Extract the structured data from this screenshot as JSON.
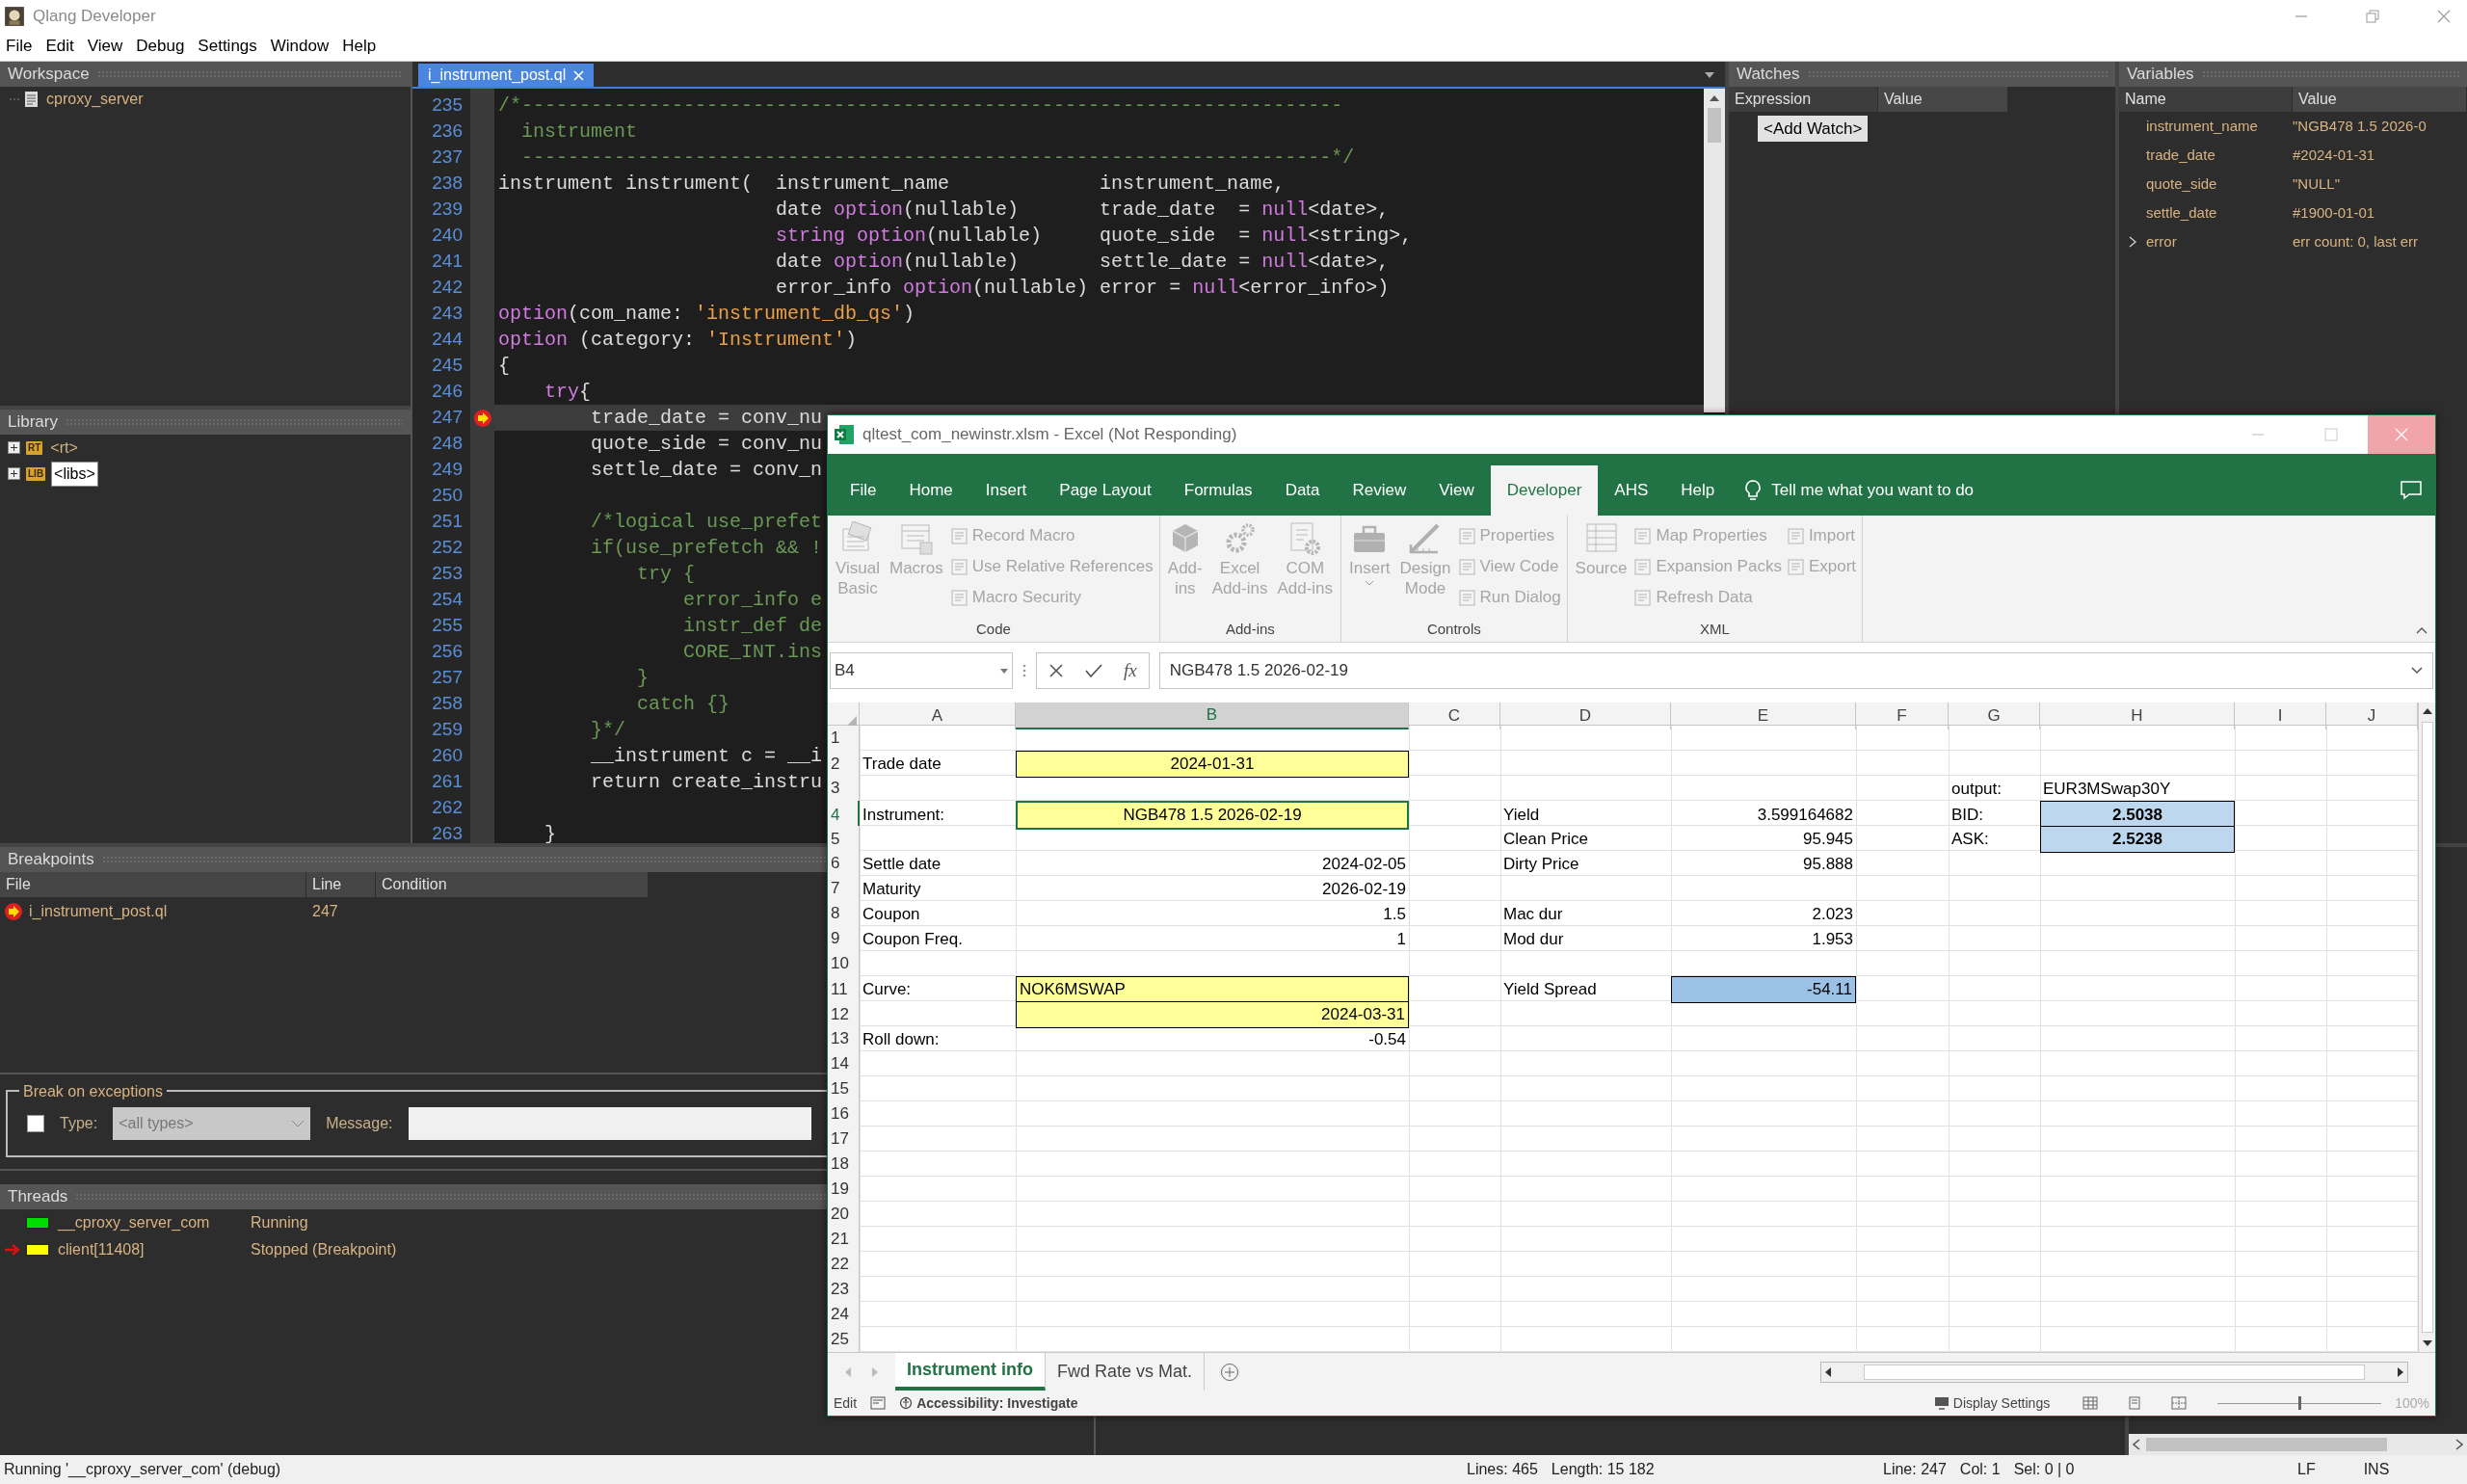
{
  "app": {
    "title": "Qlang Developer"
  },
  "menu": [
    "File",
    "Edit",
    "View",
    "Debug",
    "Settings",
    "Window",
    "Help"
  ],
  "workspace": {
    "title": "Workspace",
    "items": [
      {
        "label": "cproxy_server"
      }
    ]
  },
  "library": {
    "title": "Library",
    "items": [
      {
        "badge": "RT",
        "label": "<rt>",
        "selected": false,
        "expanded": false
      },
      {
        "badge": "LIB",
        "label": "<libs>",
        "selected": true,
        "expanded": false
      }
    ]
  },
  "editor": {
    "tab": {
      "label": "i_instrument_post.ql",
      "selected": true
    },
    "lines": [
      {
        "number": "235",
        "current": false,
        "breakpoint": false,
        "tokens": [
          {
            "text": "/*-----------------------------------------------------------------------",
            "kind": "comment"
          }
        ]
      },
      {
        "number": "236",
        "current": false,
        "breakpoint": false,
        "tokens": [
          {
            "text": "  instrument",
            "kind": "comment"
          }
        ]
      },
      {
        "number": "237",
        "current": false,
        "breakpoint": false,
        "tokens": [
          {
            "text": "  ----------------------------------------------------------------------*/",
            "kind": "comment"
          }
        ]
      },
      {
        "number": "238",
        "current": false,
        "breakpoint": false,
        "tokens": [
          {
            "text": "instrument instrument(  instrument_name             instrument_name,",
            "kind": "plain"
          }
        ]
      },
      {
        "number": "239",
        "current": false,
        "breakpoint": false,
        "tokens": [
          {
            "text": "                        date ",
            "kind": "plain"
          },
          {
            "text": "option",
            "kind": "keyword"
          },
          {
            "text": "(nullable)       trade_date  = ",
            "kind": "plain"
          },
          {
            "text": "null",
            "kind": "keyword"
          },
          {
            "text": "<date>,",
            "kind": "plain"
          }
        ]
      },
      {
        "number": "240",
        "current": false,
        "breakpoint": false,
        "tokens": [
          {
            "text": "                        string option",
            "kind": "keyword"
          },
          {
            "text": "(nullable)     quote_side  = ",
            "kind": "plain"
          },
          {
            "text": "null",
            "kind": "keyword"
          },
          {
            "text": "<string>,",
            "kind": "plain"
          }
        ]
      },
      {
        "number": "241",
        "current": false,
        "breakpoint": false,
        "tokens": [
          {
            "text": "                        date ",
            "kind": "plain"
          },
          {
            "text": "option",
            "kind": "keyword"
          },
          {
            "text": "(nullable)       settle_date = ",
            "kind": "plain"
          },
          {
            "text": "null",
            "kind": "keyword"
          },
          {
            "text": "<date>,",
            "kind": "plain"
          }
        ]
      },
      {
        "number": "242",
        "current": false,
        "breakpoint": false,
        "tokens": [
          {
            "text": "                        error_info ",
            "kind": "plain"
          },
          {
            "text": "option",
            "kind": "keyword"
          },
          {
            "text": "(nullable) error = ",
            "kind": "plain"
          },
          {
            "text": "null",
            "kind": "keyword"
          },
          {
            "text": "<error_info>)",
            "kind": "plain"
          }
        ]
      },
      {
        "number": "243",
        "current": false,
        "breakpoint": false,
        "tokens": [
          {
            "text": "option",
            "kind": "keyword"
          },
          {
            "text": "(com_name: ",
            "kind": "plain"
          },
          {
            "text": "'instrument_db_qs'",
            "kind": "string"
          },
          {
            "text": ")",
            "kind": "plain"
          }
        ]
      },
      {
        "number": "244",
        "current": false,
        "breakpoint": false,
        "tokens": [
          {
            "text": "option",
            "kind": "keyword"
          },
          {
            "text": " (category: ",
            "kind": "plain"
          },
          {
            "text": "'Instrument'",
            "kind": "string"
          },
          {
            "text": ")",
            "kind": "plain"
          }
        ]
      },
      {
        "number": "245",
        "current": false,
        "breakpoint": false,
        "tokens": [
          {
            "text": "{",
            "kind": "plain"
          }
        ]
      },
      {
        "number": "246",
        "current": false,
        "breakpoint": false,
        "tokens": [
          {
            "text": "    try",
            "kind": "keyword"
          },
          {
            "text": "{",
            "kind": "plain"
          }
        ]
      },
      {
        "number": "247",
        "current": true,
        "breakpoint": true,
        "tokens": [
          {
            "text": "        trade_date = conv_nu",
            "kind": "plain"
          }
        ]
      },
      {
        "number": "248",
        "current": false,
        "breakpoint": false,
        "tokens": [
          {
            "text": "        quote_side = conv_nu",
            "kind": "plain"
          }
        ]
      },
      {
        "number": "249",
        "current": false,
        "breakpoint": false,
        "tokens": [
          {
            "text": "        settle_date = conv_n",
            "kind": "plain"
          }
        ]
      },
      {
        "number": "250",
        "current": false,
        "breakpoint": false
      },
      {
        "number": "251",
        "current": false,
        "breakpoint": false,
        "tokens": [
          {
            "text": "        /*logical use_prefet",
            "kind": "comment"
          }
        ]
      },
      {
        "number": "252",
        "current": false,
        "breakpoint": false,
        "tokens": [
          {
            "text": "        if(use_prefetch && !",
            "kind": "comment"
          }
        ]
      },
      {
        "number": "253",
        "current": false,
        "breakpoint": false,
        "tokens": [
          {
            "text": "            try {",
            "kind": "comment"
          }
        ]
      },
      {
        "number": "254",
        "current": false,
        "breakpoint": false,
        "tokens": [
          {
            "text": "                error_info e",
            "kind": "comment"
          }
        ]
      },
      {
        "number": "255",
        "current": false,
        "breakpoint": false,
        "tokens": [
          {
            "text": "                instr_def de",
            "kind": "comment"
          }
        ]
      },
      {
        "number": "256",
        "current": false,
        "breakpoint": false,
        "tokens": [
          {
            "text": "                CORE_INT.ins",
            "kind": "comment"
          }
        ]
      },
      {
        "number": "257",
        "current": false,
        "breakpoint": false,
        "tokens": [
          {
            "text": "            }",
            "kind": "comment"
          }
        ]
      },
      {
        "number": "258",
        "current": false,
        "breakpoint": false,
        "tokens": [
          {
            "text": "            catch {}",
            "kind": "comment"
          }
        ]
      },
      {
        "number": "259",
        "current": false,
        "breakpoint": false,
        "tokens": [
          {
            "text": "        }*/",
            "kind": "comment"
          }
        ]
      },
      {
        "number": "260",
        "current": false,
        "breakpoint": false,
        "tokens": [
          {
            "text": "        __instrument c = __i",
            "kind": "plain"
          }
        ]
      },
      {
        "number": "261",
        "current": false,
        "breakpoint": false,
        "tokens": [
          {
            "text": "        return create_instru",
            "kind": "plain"
          }
        ]
      },
      {
        "number": "262",
        "current": false,
        "breakpoint": false
      },
      {
        "number": "263",
        "current": false,
        "breakpoint": false,
        "tokens": [
          {
            "text": "    }",
            "kind": "plain"
          }
        ]
      }
    ]
  },
  "watches": {
    "title": "Watches",
    "columns": [
      "Expression",
      "Value"
    ],
    "add_button": "<Add Watch>"
  },
  "variables": {
    "title": "Variables",
    "columns": [
      "Name",
      "Value"
    ],
    "rows": [
      {
        "name": "instrument_name",
        "value": "\"NGB478 1.5 2026-0",
        "expandable": false
      },
      {
        "name": "trade_date",
        "value": "#2024-01-31",
        "expandable": false
      },
      {
        "name": "quote_side",
        "value": "\"NULL\"",
        "expandable": false
      },
      {
        "name": "settle_date",
        "value": "#1900-01-01",
        "expandable": false
      },
      {
        "name": "error",
        "value": "err count: 0, last err",
        "expandable": true
      }
    ]
  },
  "breakpoints": {
    "title": "Breakpoints",
    "columns": [
      "File",
      "Line",
      "Condition"
    ],
    "rows": [
      {
        "file": "i_instrument_post.ql",
        "line": "247"
      }
    ]
  },
  "exceptions": {
    "title": "Break on exceptions",
    "checked": false,
    "type_label": "Type:",
    "type_value": "<all types>",
    "message_label": "Message:"
  },
  "threads": {
    "title": "Threads",
    "rows": [
      {
        "name": "__cproxy_server_com",
        "state": "Running",
        "color": "#00dd00",
        "current": false
      },
      {
        "name": "client[11408]",
        "state": "Stopped (Breakpoint)",
        "color": "#ffff00",
        "current": true
      }
    ]
  },
  "status_bar": {
    "message": "Running '__cproxy_server_com' (debug)",
    "document": [
      "Lines: 465",
      "Length: 15 182"
    ],
    "cursor": [
      "Line: 247",
      "Col: 1",
      "Sel: 0 | 0"
    ],
    "modes": [
      "LF",
      "INS"
    ]
  },
  "excel": {
    "title": "qltest_com_newinstr.xlsm - Excel (Not Responding)",
    "tabs": [
      {
        "label": "File",
        "selected": false
      },
      {
        "label": "Home",
        "selected": false
      },
      {
        "label": "Insert",
        "selected": false
      },
      {
        "label": "Page Layout",
        "selected": false
      },
      {
        "label": "Formulas",
        "selected": false
      },
      {
        "label": "Data",
        "selected": false
      },
      {
        "label": "Review",
        "selected": false
      },
      {
        "label": "View",
        "selected": false
      },
      {
        "label": "Developer",
        "selected": true
      },
      {
        "label": "AHS",
        "selected": false
      },
      {
        "label": "Help",
        "selected": false
      }
    ],
    "tell_me": "Tell me what you want to do",
    "groups": [
      {
        "label": "Code",
        "buttons": [
          {
            "lines": [
              "Visual",
              "Basic"
            ],
            "disabled": true,
            "dropdown": false
          },
          {
            "lines": [
              "Macros"
            ],
            "disabled": true,
            "dropdown": false
          }
        ],
        "stacks": [
          [
            {
              "label": "Record Macro",
              "disabled": true
            },
            {
              "label": "Use Relative References",
              "disabled": true
            },
            {
              "label": "Macro Security",
              "disabled": true
            }
          ]
        ]
      },
      {
        "label": "Add-ins",
        "buttons": [
          {
            "lines": [
              "Add-",
              "ins"
            ],
            "disabled": true,
            "dropdown": false
          },
          {
            "lines": [
              "Excel",
              "Add-ins"
            ],
            "disabled": true,
            "dropdown": false
          },
          {
            "lines": [
              "COM",
              "Add-ins"
            ],
            "disabled": true,
            "dropdown": false
          }
        ]
      },
      {
        "label": "Controls",
        "buttons": [
          {
            "lines": [
              "Insert"
            ],
            "disabled": true,
            "dropdown": true
          },
          {
            "lines": [
              "Design",
              "Mode"
            ],
            "disabled": true,
            "dropdown": false
          }
        ],
        "stacks": [
          [
            {
              "label": "Properties",
              "disabled": true
            },
            {
              "label": "View Code",
              "disabled": true
            },
            {
              "label": "Run Dialog",
              "disabled": true
            }
          ]
        ]
      },
      {
        "label": "XML",
        "buttons": [
          {
            "lines": [
              "Source"
            ],
            "disabled": true,
            "dropdown": false
          }
        ],
        "stacks": [
          [
            {
              "label": "Map Properties",
              "disabled": true
            },
            {
              "label": "Expansion Packs",
              "disabled": true
            },
            {
              "label": "Refresh Data",
              "disabled": true
            }
          ],
          [
            {
              "label": "Import",
              "disabled": true
            },
            {
              "label": "Export",
              "disabled": true
            }
          ]
        ]
      }
    ],
    "name_box": "B4",
    "fx": "fx",
    "formula": "NGB478 1.5 2026-02-19",
    "columns": [
      {
        "label": "A",
        "selected": false
      },
      {
        "label": "B",
        "selected": true
      },
      {
        "label": "C",
        "selected": false
      },
      {
        "label": "D",
        "selected": false
      },
      {
        "label": "E",
        "selected": false
      },
      {
        "label": "F",
        "selected": false
      },
      {
        "label": "G",
        "selected": false
      },
      {
        "label": "H",
        "selected": false
      },
      {
        "label": "I",
        "selected": false
      },
      {
        "label": "J",
        "selected": false
      }
    ],
    "rows": [
      {
        "label": "1",
        "selected": false
      },
      {
        "label": "2",
        "selected": false,
        "cells": {
          "A": {
            "text": "Trade date",
            "kind": "text",
            "selected": false
          },
          "B": {
            "text": "2024-01-31",
            "kind": "centered",
            "color": "#ffff99",
            "border": true,
            "selected": false
          }
        }
      },
      {
        "label": "3",
        "selected": false,
        "cells": {
          "G": {
            "text": "output:",
            "kind": "text",
            "selected": false
          },
          "H": {
            "text": "EUR3MSwap30Y",
            "kind": "text",
            "selected": false
          }
        }
      },
      {
        "label": "4",
        "selected": true,
        "cells": {
          "A": {
            "text": "Instrument:",
            "kind": "text",
            "selected": false
          },
          "B": {
            "text": "NGB478 1.5 2026-02-19",
            "kind": "centered",
            "color": "#ffff99",
            "border": true,
            "selected": true
          },
          "D": {
            "text": "Yield",
            "kind": "text",
            "selected": false
          },
          "E": {
            "text": "3.599164682",
            "kind": "number",
            "selected": false
          },
          "G": {
            "text": "BID:",
            "kind": "text",
            "selected": false
          },
          "H": {
            "text": "2.5038",
            "kind": "centered",
            "color": "#bdd7ee",
            "border": true,
            "bold": true,
            "selected": false
          }
        }
      },
      {
        "label": "5",
        "selected": false,
        "cells": {
          "D": {
            "text": "Clean Price",
            "kind": "text",
            "selected": false
          },
          "E": {
            "text": "95.945",
            "kind": "number",
            "selected": false
          },
          "G": {
            "text": "ASK:",
            "kind": "text",
            "selected": false
          },
          "H": {
            "text": "2.5238",
            "kind": "centered",
            "color": "#bdd7ee",
            "border": true,
            "bold": true,
            "selected": false
          }
        }
      },
      {
        "label": "6",
        "selected": false,
        "cells": {
          "A": {
            "text": "Settle date",
            "kind": "text",
            "selected": false
          },
          "B": {
            "text": "2024-02-05",
            "kind": "number",
            "selected": false
          },
          "D": {
            "text": "Dirty Price",
            "kind": "text",
            "selected": false
          },
          "E": {
            "text": "95.888",
            "kind": "number",
            "selected": false
          }
        }
      },
      {
        "label": "7",
        "selected": false,
        "cells": {
          "A": {
            "text": "Maturity",
            "kind": "text",
            "selected": false
          },
          "B": {
            "text": "2026-02-19",
            "kind": "number",
            "selected": false
          }
        }
      },
      {
        "label": "8",
        "selected": false,
        "cells": {
          "A": {
            "text": "Coupon",
            "kind": "text",
            "selected": false
          },
          "B": {
            "text": "1.5",
            "kind": "number",
            "selected": false
          },
          "D": {
            "text": "Mac dur",
            "kind": "text",
            "selected": false
          },
          "E": {
            "text": "2.023",
            "kind": "number",
            "selected": false
          }
        }
      },
      {
        "label": "9",
        "selected": false,
        "cells": {
          "A": {
            "text": "Coupon Freq.",
            "kind": "text",
            "selected": false
          },
          "B": {
            "text": "1",
            "kind": "number",
            "selected": false
          },
          "D": {
            "text": "Mod dur",
            "kind": "text",
            "selected": false
          },
          "E": {
            "text": "1.953",
            "kind": "number",
            "selected": false
          }
        }
      },
      {
        "label": "10",
        "selected": false
      },
      {
        "label": "11",
        "selected": false,
        "cells": {
          "A": {
            "text": "Curve:",
            "kind": "text",
            "selected": false
          },
          "B": {
            "text": "NOK6MSWAP",
            "kind": "text",
            "color": "#ffff99",
            "border": true,
            "selected": false
          },
          "D": {
            "text": "Yield Spread",
            "kind": "text",
            "selected": false
          },
          "E": {
            "text": "-54.11",
            "kind": "number",
            "color": "#9bc2e6",
            "border": true,
            "selected": false
          }
        }
      },
      {
        "label": "12",
        "selected": false,
        "cells": {
          "B": {
            "text": "2024-03-31",
            "kind": "number",
            "color": "#ffff99",
            "border": true,
            "selected": false
          }
        }
      },
      {
        "label": "13",
        "selected": false,
        "cells": {
          "A": {
            "text": "Roll down:",
            "kind": "text",
            "selected": false
          },
          "B": {
            "text": "-0.54",
            "kind": "number",
            "selected": false
          }
        }
      },
      {
        "label": "14",
        "selected": false
      },
      {
        "label": "15",
        "selected": false
      },
      {
        "label": "16",
        "selected": false
      },
      {
        "label": "17",
        "selected": false
      },
      {
        "label": "18",
        "selected": false
      },
      {
        "label": "19",
        "selected": false
      },
      {
        "label": "20",
        "selected": false
      },
      {
        "label": "21",
        "selected": false
      },
      {
        "label": "22",
        "selected": false
      },
      {
        "label": "23",
        "selected": false
      },
      {
        "label": "24",
        "selected": false
      },
      {
        "label": "25",
        "selected": false
      }
    ],
    "sheets": [
      {
        "label": "Instrument info",
        "selected": true
      },
      {
        "label": "Fwd Rate vs Mat.",
        "selected": false
      }
    ],
    "status": {
      "mode": "Edit",
      "accessibility": "Accessibility: Investigate",
      "display": "Display Settings",
      "zoom": "100%",
      "level": 0.5
    }
  }
}
